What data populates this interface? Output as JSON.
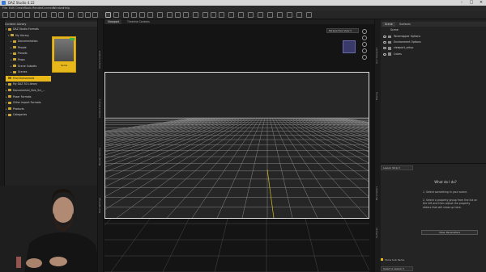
{
  "app": {
    "title": "DAZ Studio 4.22"
  },
  "menu": [
    "File",
    "Edit",
    "Create",
    "Tools",
    "Render",
    "Connect",
    "Window",
    "Help"
  ],
  "content_library": {
    "header": "Content Library",
    "tree": [
      {
        "label": "DAZ Studio Formats",
        "depth": 0,
        "type": "folder"
      },
      {
        "label": "My Library",
        "depth": 1,
        "type": "folder"
      },
      {
        "label": "Documentation",
        "depth": 2,
        "type": "folder"
      },
      {
        "label": "People",
        "depth": 2,
        "type": "folder"
      },
      {
        "label": "Presets",
        "depth": 2,
        "type": "folder"
      },
      {
        "label": "Props",
        "depth": 2,
        "type": "folder"
      },
      {
        "label": "Scene Subsets",
        "depth": 2,
        "type": "folder"
      },
      {
        "label": "Scenes",
        "depth": 2,
        "type": "folder"
      },
      {
        "label": "Find Duhummed",
        "depth": 0,
        "type": "folder",
        "selected": true
      },
      {
        "label": "My DAZ 3D Library",
        "depth": 0,
        "type": "folder"
      },
      {
        "label": "Documented_Size_Sci_...",
        "depth": 0,
        "type": "folder"
      },
      {
        "label": "Poser Formats",
        "depth": 0,
        "type": "folder"
      },
      {
        "label": "Other Import Formats",
        "depth": 0,
        "type": "folder"
      },
      {
        "label": "Products",
        "depth": 0,
        "type": "folder"
      },
      {
        "label": "Categories",
        "depth": 0,
        "type": "folder"
      }
    ],
    "thumbnail_label": "Items"
  },
  "viewport": {
    "tabs": [
      "Viewport",
      "Timeline Controls"
    ],
    "active_tab": 0,
    "view_select": "Perspective View"
  },
  "scene": {
    "tabs": [
      "Scene",
      "Surfaces"
    ],
    "active_tab": 0,
    "root_label": "Scene",
    "items": [
      {
        "label": "Tonemapper Options"
      },
      {
        "label": "Environment Options"
      },
      {
        "label": "viewport_setup"
      },
      {
        "label": "Cubes"
      }
    ]
  },
  "lesson": {
    "select": "Lesson Strip",
    "title": "What do I do?",
    "steps": [
      "1. Select something in your scene.",
      "2. Select a property group from the list on the left and then adjust the property sliders that will show up here."
    ],
    "button": "View: Parameters",
    "checkbox_label": "Show Sub Items",
    "footer_select": "Select a Lesson"
  },
  "colors": {
    "accent": "#e8b71a",
    "bg": "#1e1e1e",
    "grid": "#9a9a9a"
  }
}
